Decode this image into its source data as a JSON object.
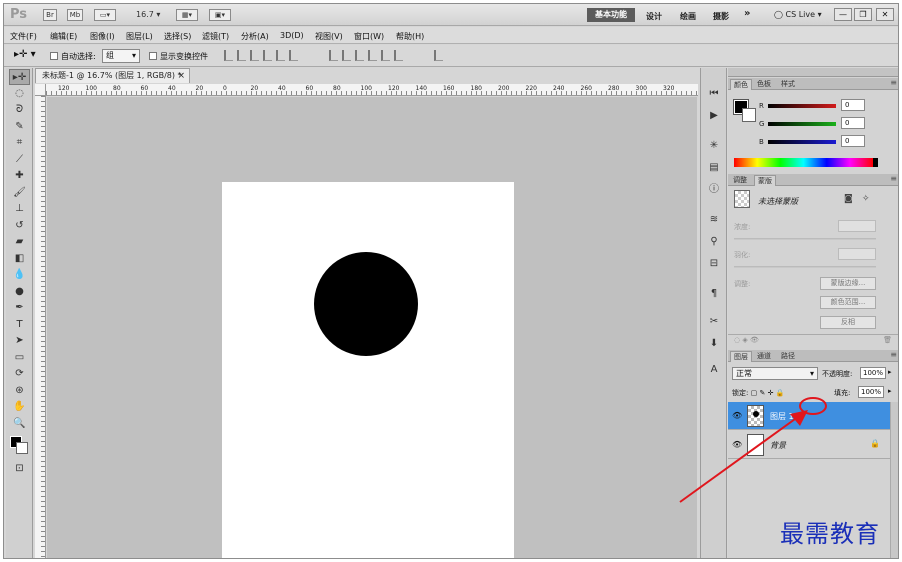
{
  "appbar": {
    "logo": "Ps",
    "btn_br": "Br",
    "btn_mb": "Mb",
    "zoom": "16.7",
    "workspaces": [
      "基本功能",
      "设计",
      "绘画",
      "摄影"
    ],
    "more": "»",
    "cslive": "CS Live"
  },
  "menu": [
    "文件(F)",
    "编辑(E)",
    "图像(I)",
    "图层(L)",
    "选择(S)",
    "滤镜(T)",
    "分析(A)",
    "3D(D)",
    "视图(V)",
    "窗口(W)",
    "帮助(H)"
  ],
  "options": {
    "auto_select_label": "自动选择:",
    "auto_select_value": "组",
    "show_transform_label": "显示变换控件"
  },
  "document": {
    "tab_title": "未标题-1 @ 16.7% (图层 1, RGB/8) *",
    "ruler_ticks": [
      "120",
      "100",
      "80",
      "60",
      "40",
      "20",
      "0",
      "20",
      "40",
      "60",
      "80",
      "100",
      "120",
      "140",
      "160",
      "180",
      "200",
      "220",
      "240",
      "260",
      "280",
      "300",
      "320"
    ]
  },
  "color_panel": {
    "tabs": [
      "颜色",
      "色板",
      "样式"
    ],
    "channels": [
      {
        "label": "R",
        "value": "0",
        "color": "#d21c1c"
      },
      {
        "label": "G",
        "value": "0",
        "color": "#1ab01a"
      },
      {
        "label": "B",
        "value": "0",
        "color": "#1c1cd2"
      }
    ]
  },
  "masks_panel": {
    "tabs": [
      "调整",
      "蒙版"
    ],
    "title": "未选择蒙版",
    "density_label": "浓度:",
    "feather_label": "羽化:",
    "refine_label": "调整:",
    "btn_edge": "蒙版边缘...",
    "btn_range": "颜色范围...",
    "btn_invert": "反相"
  },
  "layers_panel": {
    "tabs": [
      "图层",
      "通道",
      "路径"
    ],
    "blend_mode": "正常",
    "opacity_label": "不透明度:",
    "opacity": "100%",
    "lock_label": "锁定:",
    "fill_label": "填充:",
    "fill": "100%",
    "layers": [
      {
        "name": "图层 1",
        "selected": true
      },
      {
        "name": "背景",
        "selected": false
      }
    ]
  },
  "annotation_color": "#e0161d",
  "watermark": "最需教育"
}
